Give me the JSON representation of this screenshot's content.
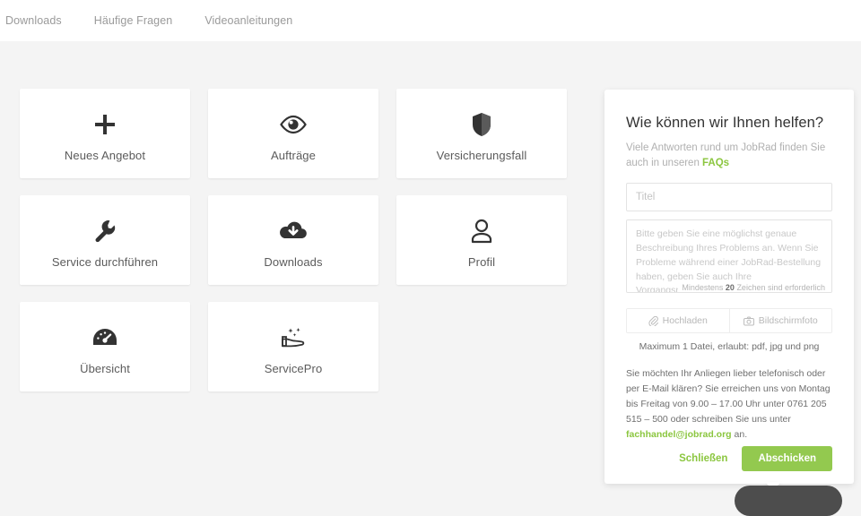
{
  "topnav": {
    "items": [
      {
        "label": "Downloads",
        "name": "nav-downloads"
      },
      {
        "label": "Häufige Fragen",
        "name": "nav-haeufige-fragen"
      },
      {
        "label": "Videoanleitungen",
        "name": "nav-videoanleitungen"
      }
    ]
  },
  "tiles": [
    {
      "label": "Neues Angebot",
      "icon": "plus-icon"
    },
    {
      "label": "Aufträge",
      "icon": "eye-icon"
    },
    {
      "label": "Versicherungsfall",
      "icon": "shield-icon"
    },
    {
      "label": "Service durchführen",
      "icon": "wrench-icon"
    },
    {
      "label": "Downloads",
      "icon": "cloud-download-icon"
    },
    {
      "label": "Profil",
      "icon": "person-icon"
    },
    {
      "label": "Übersicht",
      "icon": "gauge-icon"
    },
    {
      "label": "ServicePro",
      "icon": "hand-sparkle-icon"
    }
  ],
  "help_panel": {
    "title": "Wie können wir Ihnen helfen?",
    "subtitle_before": "Viele Antworten rund um JobRad finden Sie auch in unseren ",
    "faq_link": "FAQs",
    "title_input": {
      "value": "",
      "placeholder": "Titel"
    },
    "description_input": {
      "value": "",
      "placeholder": "Bitte geben Sie eine möglichst genaue Beschreibung Ihres Problems an. Wenn Sie Probleme während einer JobRad-Bestellung haben, geben Sie auch Ihre Vorgangsnummer mit an."
    },
    "char_hint_prefix": "Mindestens ",
    "char_hint_count": "20",
    "char_hint_suffix": " Zeichen sind erforderlich",
    "upload_button": {
      "label": "Hochladen",
      "icon": "paperclip-icon"
    },
    "screenshot_button": {
      "label": "Bildschirmfoto",
      "icon": "camera-icon"
    },
    "file_note": "Maximum 1 Datei, erlaubt: pdf, jpg und png",
    "contact_text": "Sie möchten Ihr Anliegen lieber telefonisch oder per E-Mail klären? Sie erreichen uns von Montag bis Freitag von 9.00 – 17.00 Uhr unter 0761 205 515 – 500 oder schreiben Sie uns unter ",
    "contact_email": "fachhandel@jobrad.org",
    "contact_text_after": " an.",
    "close_button": "Schließen",
    "submit_button": "Abschicken"
  },
  "colors": {
    "brand_green": "#8bc63f",
    "submit_green": "#93c94f",
    "page_background": "#f4f4f4",
    "tile_background": "#ffffff",
    "text_muted": "#9a9a9a"
  }
}
